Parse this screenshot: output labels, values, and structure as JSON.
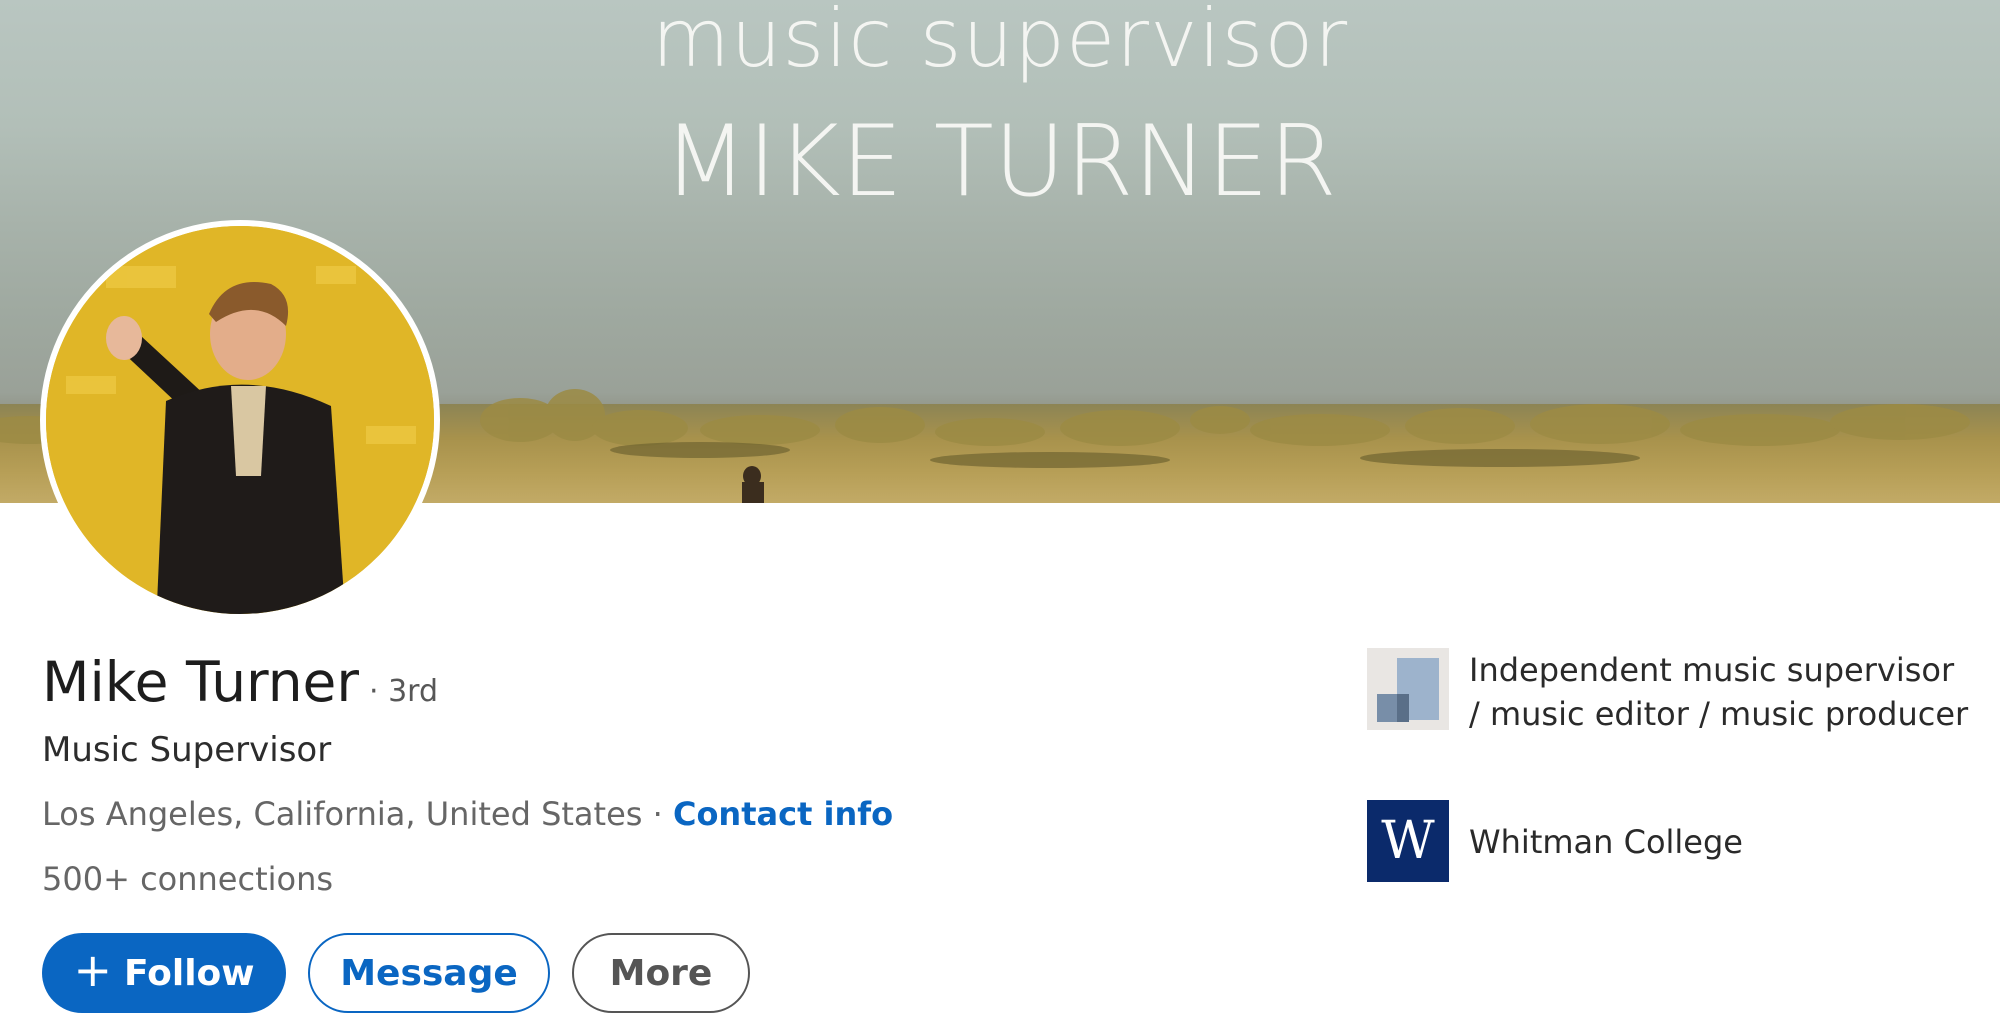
{
  "banner": {
    "line1": "music supervisor",
    "line2": "MIKE TURNER"
  },
  "profile": {
    "name": "Mike Turner",
    "degree": "· 3rd",
    "headline": "Music Supervisor",
    "location": "Los Angeles, California, United States",
    "location_separator": " · ",
    "contact_label": "Contact info",
    "connections": "500+ connections"
  },
  "actions": {
    "follow_icon": "+",
    "follow_label": "Follow",
    "message_label": "Message",
    "more_label": "More"
  },
  "side": {
    "company": "Independent music supervisor / music editor / music producer",
    "school": "Whitman College",
    "school_logo_letter": "W"
  },
  "colors": {
    "brand_blue": "#0a66c2",
    "school_navy": "#0b2a6b"
  },
  "icons": {
    "follow": "plus-icon",
    "company": "company-logo-icon",
    "school": "school-logo-icon"
  }
}
